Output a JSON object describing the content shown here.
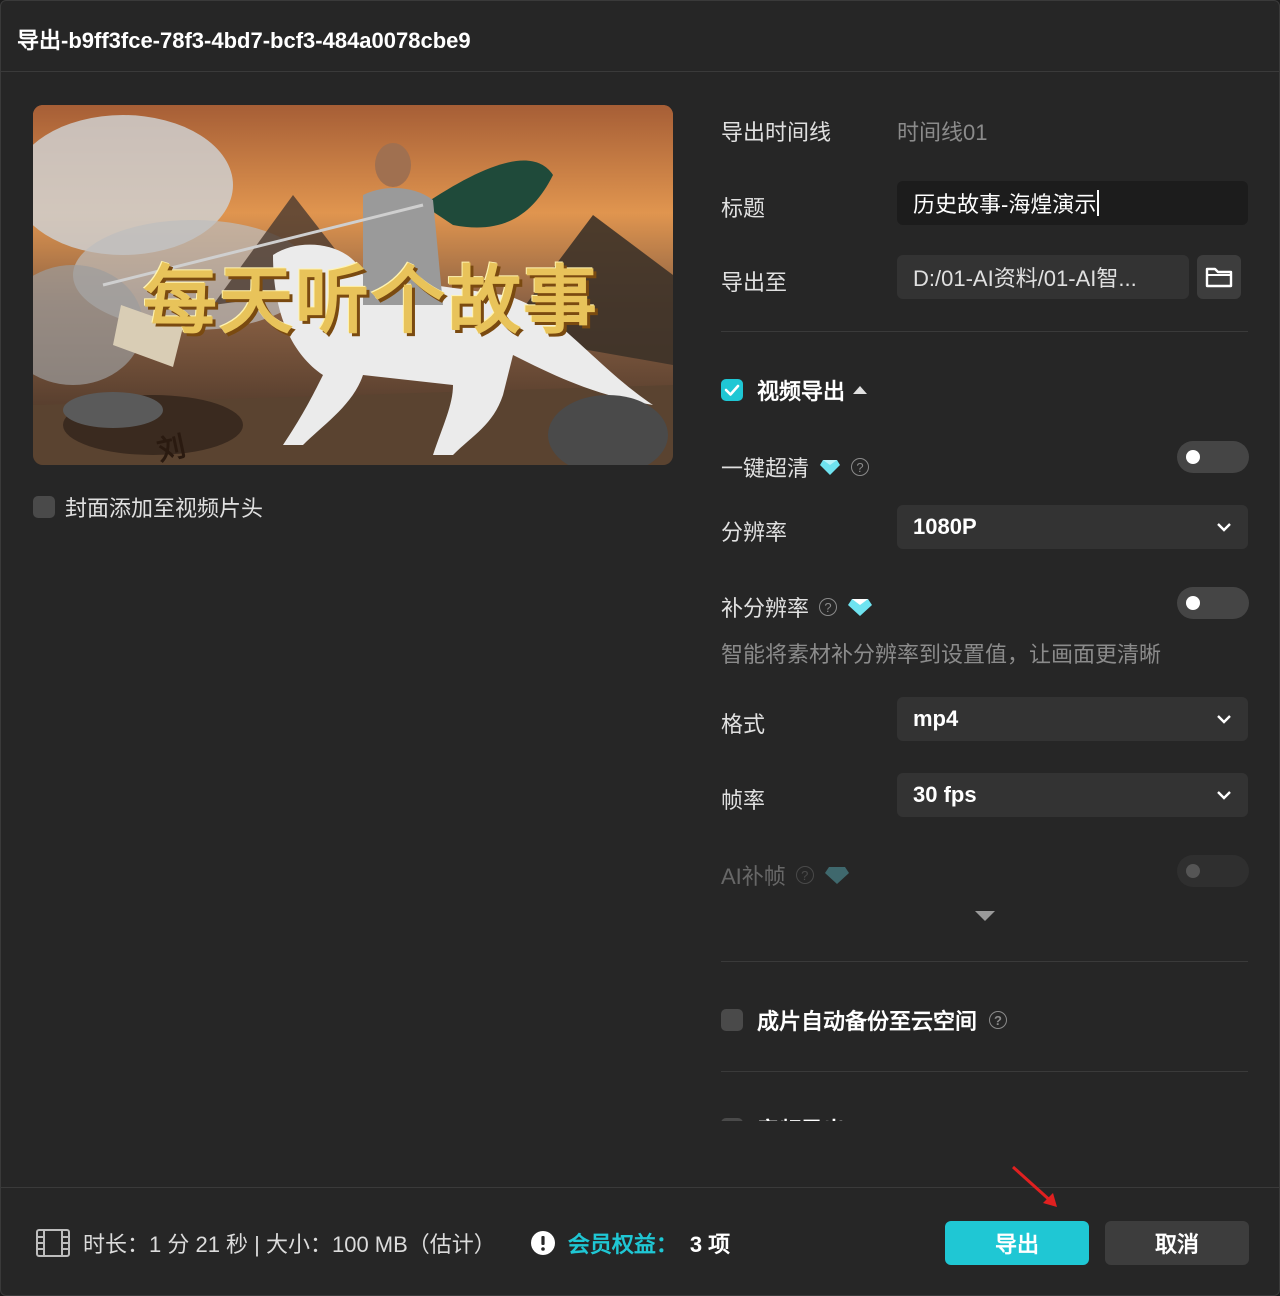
{
  "window": {
    "title": "导出-b9ff3fce-78f3-4bd7-bcf3-484a0078cbe9"
  },
  "preview": {
    "cover_text": "每天听个故事",
    "flag_text": "刘",
    "cover_to_head_label": "封面添加至视频片头",
    "cover_to_head_checked": false
  },
  "export": {
    "timeline_label": "导出时间线",
    "timeline_value": "时间线01",
    "title_label": "标题",
    "title_value": "历史故事-海煌演示",
    "path_label": "导出至",
    "path_value": "D:/01-AI资料/01-AI智..."
  },
  "video": {
    "section_label": "视频导出",
    "checked": true,
    "one_click_hd_label": "一键超清",
    "resolution_label": "分辨率",
    "resolution_value": "1080P",
    "super_res_label": "补分辨率",
    "super_res_hint": "智能将素材补分辨率到设置值，让画面更清晰",
    "format_label": "格式",
    "format_value": "mp4",
    "fps_label": "帧率",
    "fps_value": "30 fps",
    "ai_frame_label": "AI补帧"
  },
  "backup": {
    "label": "成片自动备份至云空间",
    "checked": false
  },
  "audio": {
    "label": "音频导出"
  },
  "footer": {
    "info": "时长：1 分 21 秒 | 大小：100 MB（估计）",
    "member_label": "会员权益：",
    "member_count": "3 项",
    "export_button": "导出",
    "cancel_button": "取消"
  },
  "colors": {
    "accent": "#1fc7d4",
    "background": "#262626",
    "field": "#333333"
  }
}
